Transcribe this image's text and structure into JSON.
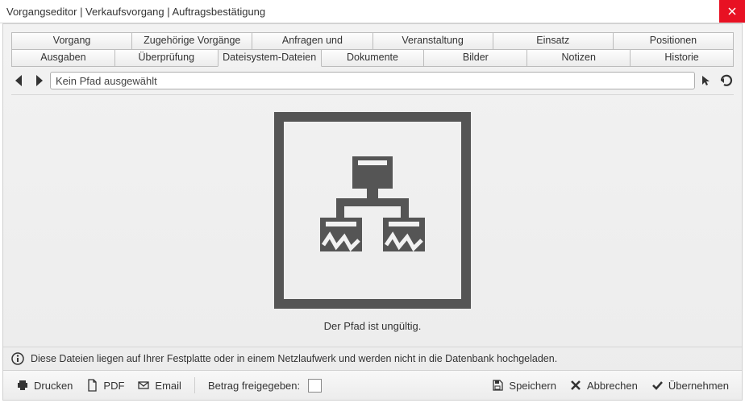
{
  "window": {
    "title": "Vorgangseditor | Verkaufsvorgang | Auftragsbestätigung"
  },
  "tabsRow1": [
    {
      "label": "Vorgang"
    },
    {
      "label": "Zugehörige Vorgänge"
    },
    {
      "label": "Anfragen und Bestellungen"
    },
    {
      "label": "Veranstaltung"
    },
    {
      "label": "Einsatz"
    },
    {
      "label": "Positionen"
    }
  ],
  "tabsRow2": [
    {
      "label": "Ausgaben"
    },
    {
      "label": "Überprüfung"
    },
    {
      "label": "Dateisystem-Dateien",
      "active": true
    },
    {
      "label": "Dokumente"
    },
    {
      "label": "Bilder"
    },
    {
      "label": "Notizen"
    },
    {
      "label": "Historie"
    }
  ],
  "path": {
    "value": "Kein Pfad ausgewählt"
  },
  "main": {
    "message": "Der Pfad ist ungültig."
  },
  "info": {
    "text": "Diese Dateien liegen auf Ihrer Festplatte oder in einem Netzlaufwerk und werden nicht in die Datenbank hochgeladen."
  },
  "footer": {
    "print": "Drucken",
    "pdf": "PDF",
    "email": "Email",
    "release_label": "Betrag freigegeben:",
    "save": "Speichern",
    "cancel": "Abbrechen",
    "apply": "Übernehmen"
  }
}
